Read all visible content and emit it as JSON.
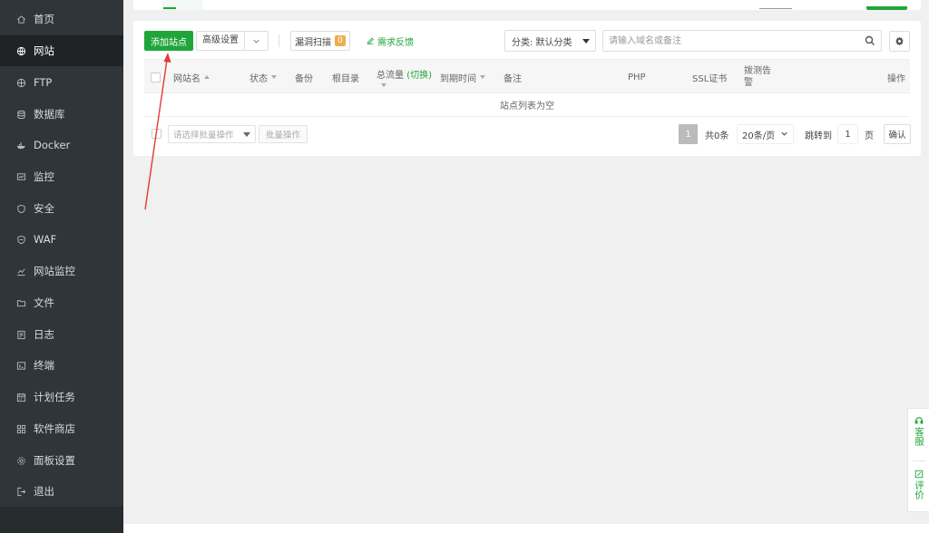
{
  "sidebar": {
    "items": [
      {
        "label": "首页",
        "icon": "home-icon"
      },
      {
        "label": "网站",
        "icon": "globe-icon",
        "active": true
      },
      {
        "label": "FTP",
        "icon": "ftp-globe-icon"
      },
      {
        "label": "数据库",
        "icon": "database-icon"
      },
      {
        "label": "Docker",
        "icon": "docker-icon"
      },
      {
        "label": "监控",
        "icon": "monitor-icon"
      },
      {
        "label": "安全",
        "icon": "shield-icon"
      },
      {
        "label": "WAF",
        "icon": "waf-shield-icon"
      },
      {
        "label": "网站监控",
        "icon": "chart-icon"
      },
      {
        "label": "文件",
        "icon": "folder-icon"
      },
      {
        "label": "日志",
        "icon": "log-icon"
      },
      {
        "label": "终端",
        "icon": "terminal-icon"
      },
      {
        "label": "计划任务",
        "icon": "calendar-icon"
      },
      {
        "label": "软件商店",
        "icon": "grid-icon"
      },
      {
        "label": "面板设置",
        "icon": "gear-icon"
      },
      {
        "label": "退出",
        "icon": "logout-icon"
      }
    ]
  },
  "toolbar": {
    "add_site": "添加站点",
    "advanced": "高级设置",
    "scan": "漏洞扫描",
    "scan_count": "0",
    "feedback": "需求反馈",
    "category": "分类: 默认分类",
    "search_placeholder": "请输入域名或备注"
  },
  "table": {
    "headers": {
      "name": "网站名",
      "status": "状态",
      "backup": "备份",
      "root": "根目录",
      "traffic": "总流量",
      "traffic_switch": "(切换)",
      "expire": "到期时间",
      "note": "备注",
      "php": "PHP",
      "ssl": "SSL证书",
      "alert_line1": "拨测告",
      "alert_line2": "警",
      "actions": "操作"
    },
    "empty_text": "站点列表为空"
  },
  "footer": {
    "batch_placeholder": "请选择批量操作",
    "batch_button": "批量操作",
    "current_page": "1",
    "total": "共0条",
    "page_size": "20条/页",
    "jump_label": "跳转到",
    "jump_value": "1",
    "page_unit": "页",
    "confirm": "确认"
  },
  "float_panel": {
    "support": "客服",
    "rate": "评价"
  },
  "colors": {
    "accent": "#20a53a",
    "sidebar_bg": "#2f3539",
    "annotation": "#e53935"
  }
}
